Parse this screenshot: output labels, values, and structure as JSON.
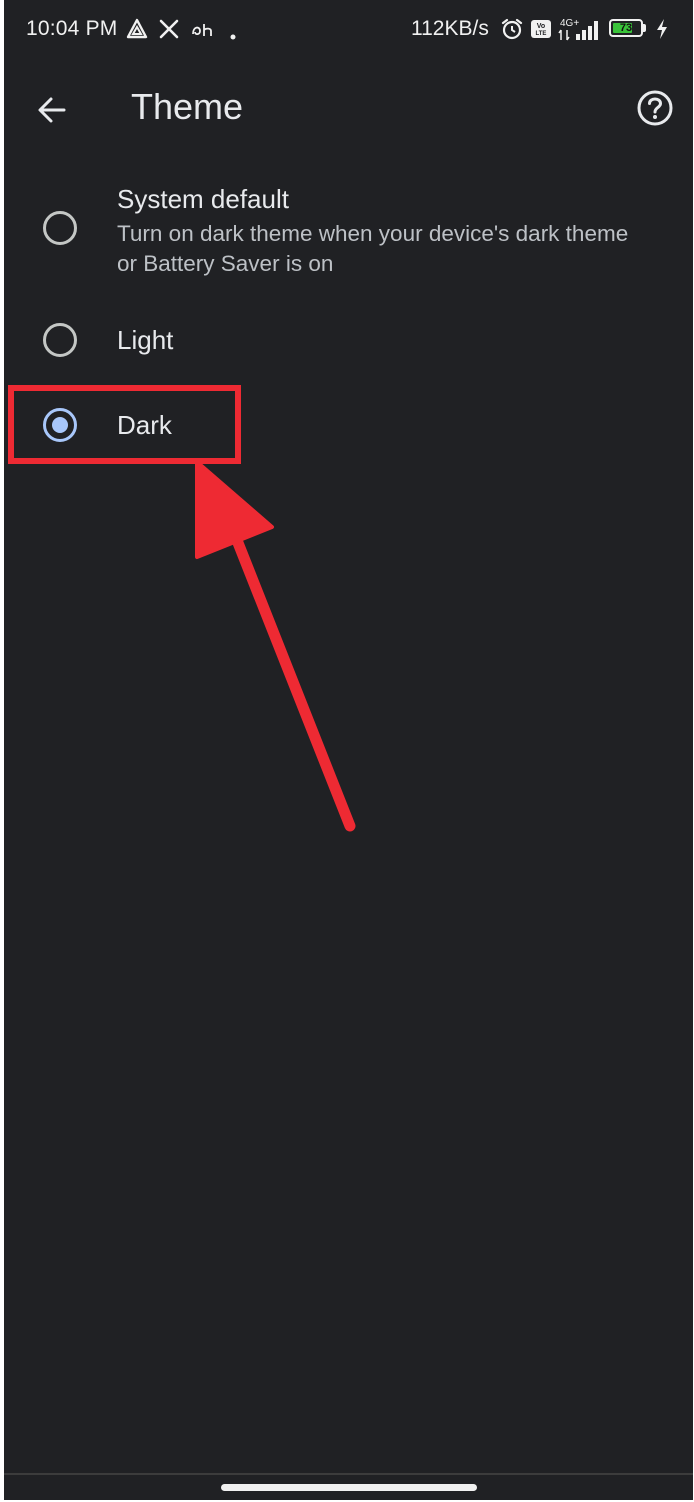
{
  "status_bar": {
    "time": "10:04 PM",
    "notification_icons": [
      "app-triangle-icon",
      "x-logo-icon",
      "dh-app-icon",
      "dot-icon"
    ],
    "network_speed": "112KB/s",
    "network_type": "4G+",
    "volte_label": "Vo LTE",
    "battery_level": "73",
    "charging": true
  },
  "app_bar": {
    "title": "Theme",
    "back_icon": "arrow-back-icon",
    "help_icon": "help-circle-icon"
  },
  "theme_options": [
    {
      "title": "System default",
      "description": "Turn on dark theme when your device's dark theme or Battery Saver is on",
      "selected": false
    },
    {
      "title": "Light",
      "selected": false
    },
    {
      "title": "Dark",
      "selected": true
    }
  ],
  "annotation": {
    "color": "#ee2a33",
    "highlighted_option": "Dark"
  },
  "colors": {
    "background": "#202124",
    "accent": "#a8c7fa",
    "text_primary": "#e8eaed",
    "text_secondary": "#bdc1c6"
  }
}
